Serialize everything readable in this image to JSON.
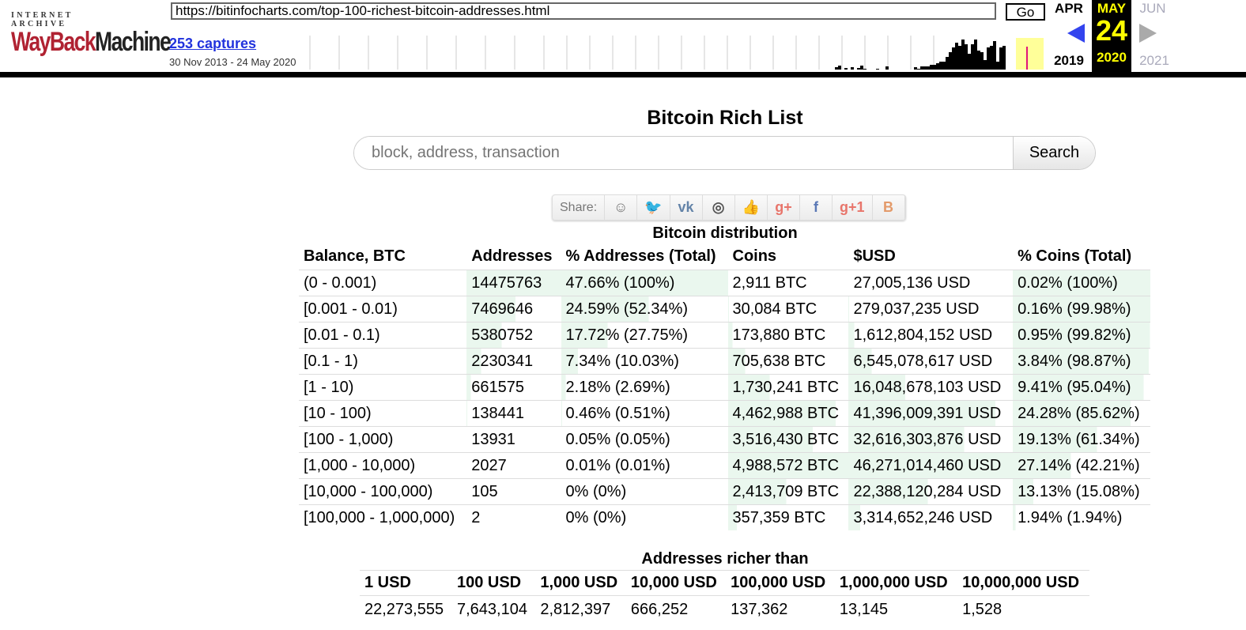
{
  "wayback": {
    "logo_top": "INTERNET ARCHIVE",
    "logo_a": "WayBack",
    "logo_b": "Machine",
    "url": "https://bitinfocharts.com/top-100-richest-bitcoin-addresses.html",
    "go": "Go",
    "captures": "253 captures",
    "range": "30 Nov 2013 - 24 May 2020",
    "prev_month": "APR",
    "prev_year": "2019",
    "cur_month": "MAY",
    "cur_day": "24",
    "cur_year": "2020",
    "next_month": "JUN",
    "next_year": "2021"
  },
  "page": {
    "title": "Bitcoin Rich List",
    "search_placeholder": "block, address, transaction",
    "search_button": "Search",
    "share_label": "Share:",
    "share_icons": [
      "reddit-icon",
      "twitter-icon",
      "vk-icon",
      "weibo-icon",
      "like-icon",
      "google-plus-icon",
      "facebook-icon",
      "google-plus-one-icon",
      "blogger-icon"
    ],
    "share_colors": [
      "#777777",
      "#55acee",
      "#6383a8",
      "#555555",
      "#5b7ec4",
      "#e8756b",
      "#5a78b5",
      "#e8756b",
      "#e39a6a"
    ],
    "bar_color": "#eaf7ee"
  },
  "distribution": {
    "caption": "Bitcoin distribution",
    "headers": [
      "Balance, BTC",
      "Addresses",
      "% Addresses (Total)",
      "Coins",
      "$USD",
      "% Coins (Total)"
    ],
    "rows": [
      [
        "(0 - 0.001)",
        "14475763",
        "47.66% (100%)",
        "2,911 BTC",
        "27,005,136 USD",
        "0.02% (100%)"
      ],
      [
        "[0.001 - 0.01)",
        "7469646",
        "24.59% (52.34%)",
        "30,084 BTC",
        "279,037,235 USD",
        "0.16% (99.98%)"
      ],
      [
        "[0.01 - 0.1)",
        "5380752",
        "17.72% (27.75%)",
        "173,880 BTC",
        "1,612,804,152 USD",
        "0.95% (99.82%)"
      ],
      [
        "[0.1 - 1)",
        "2230341",
        "7.34% (10.03%)",
        "705,638 BTC",
        "6,545,078,617 USD",
        "3.84% (98.87%)"
      ],
      [
        "[1 - 10)",
        "661575",
        "2.18% (2.69%)",
        "1,730,241 BTC",
        "16,048,678,103 USD",
        "9.41% (95.04%)"
      ],
      [
        "[10 - 100)",
        "138441",
        "0.46% (0.51%)",
        "4,462,988 BTC",
        "41,396,009,391 USD",
        "24.28% (85.62%)"
      ],
      [
        "[100 - 1,000)",
        "13931",
        "0.05% (0.05%)",
        "3,516,430 BTC",
        "32,616,303,876 USD",
        "19.13% (61.34%)"
      ],
      [
        "[1,000 - 10,000)",
        "2027",
        "0.01% (0.01%)",
        "4,988,572 BTC",
        "46,271,014,460 USD",
        "27.14% (42.21%)"
      ],
      [
        "[10,000 - 100,000)",
        "105",
        "0% (0%)",
        "2,413,709 BTC",
        "22,388,120,284 USD",
        "13.13% (15.08%)"
      ],
      [
        "[100,000 - 1,000,000)",
        "2",
        "0% (0%)",
        "357,359 BTC",
        "3,314,652,246 USD",
        "1.94% (1.94%)"
      ]
    ]
  },
  "richer": {
    "caption": "Addresses richer than",
    "headers": [
      "1 USD",
      "100 USD",
      "1,000 USD",
      "10,000 USD",
      "100,000 USD",
      "1,000,000 USD",
      "10,000,000 USD"
    ],
    "values": [
      "22,273,555",
      "7,643,104",
      "2,812,397",
      "666,252",
      "137,362",
      "13,145",
      "1,528"
    ]
  }
}
